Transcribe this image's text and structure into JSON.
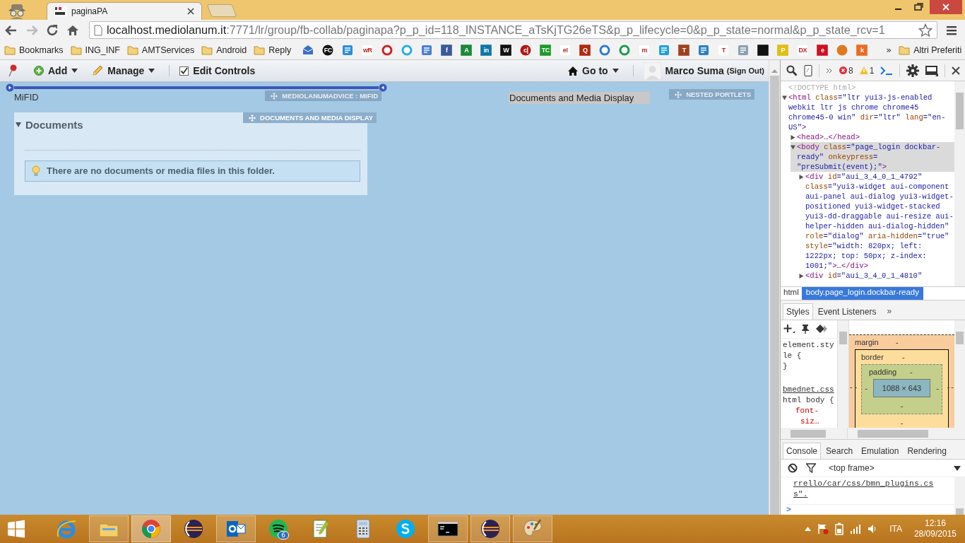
{
  "browser": {
    "tabs": [
      {
        "title": "paginaPA",
        "selected": true
      }
    ],
    "url": {
      "host": "localhost.mediolanum.it",
      "path": ":7771/lr/group/fb-collab/paginapa?p_p_id=118_INSTANCE_aTsKjTG26eTS&p_p_lifecycle=0&p_p_state=normal&p_p_state_rcv=1"
    },
    "bookmarks": {
      "folders": [
        "Bookmarks",
        "ING_INF",
        "AMTServices",
        "Android",
        "Reply"
      ],
      "sites": [
        {
          "kind": "mail",
          "color": "#3b6fc4"
        },
        {
          "kind": "circle",
          "color": "#111111",
          "glyph": "FC"
        },
        {
          "kind": "box",
          "color": "#2a8ee0"
        },
        {
          "kind": "square",
          "color": "#ffffff",
          "glyph": "wR"
        },
        {
          "kind": "ring",
          "color": "#d02020"
        },
        {
          "kind": "ring",
          "color": "#20b0e0"
        },
        {
          "kind": "box",
          "color": "#4a7fd8"
        },
        {
          "kind": "square",
          "color": "#3b5998",
          "glyph": "f"
        },
        {
          "kind": "square",
          "color": "#1a8a3a",
          "glyph": "A"
        },
        {
          "kind": "square",
          "color": "#0e76a8",
          "glyph": "in"
        },
        {
          "kind": "square",
          "color": "#111111",
          "glyph": "W"
        },
        {
          "kind": "circle",
          "color": "#b01818",
          "glyph": "c|"
        },
        {
          "kind": "square",
          "color": "#1a9a2a",
          "glyph": "TC"
        },
        {
          "kind": "square",
          "color": "#ffffff",
          "glyph": "e!"
        },
        {
          "kind": "square",
          "color": "#b02a10",
          "glyph": "Q"
        },
        {
          "kind": "ring",
          "color": "#2a7ad8"
        },
        {
          "kind": "ring",
          "color": "#1a9a4a"
        },
        {
          "kind": "square",
          "color": "#ffffff",
          "glyph": "m"
        },
        {
          "kind": "box",
          "color": "#20a0e0"
        },
        {
          "kind": "square",
          "color": "#a0401a",
          "glyph": "T"
        },
        {
          "kind": "box",
          "color": "#2a80c0"
        },
        {
          "kind": "square",
          "color": "#ffffff",
          "glyph": "T"
        },
        {
          "kind": "box",
          "color": "#8aa0b0"
        },
        {
          "kind": "square",
          "color": "#111111"
        },
        {
          "kind": "square",
          "color": "#e0c010",
          "glyph": "P"
        },
        {
          "kind": "square",
          "color": "#ffffff",
          "glyph": "DX"
        },
        {
          "kind": "square",
          "color": "#d01020",
          "glyph": "e"
        },
        {
          "kind": "circle",
          "color": "#e07a20"
        },
        {
          "kind": "square",
          "color": "#f06a20",
          "glyph": "k"
        }
      ],
      "overflow": "»",
      "other": "Altri Preferiti"
    }
  },
  "dockbar": {
    "menus": [
      {
        "kind": "add",
        "label": "Add"
      },
      {
        "kind": "manage",
        "label": "Manage"
      }
    ],
    "edit_controls": {
      "label": "Edit Controls",
      "checked": true
    },
    "goto": "Go to",
    "user": {
      "name": "Marco Suma",
      "sign_out": "(Sign Out)"
    }
  },
  "page": {
    "column_title": "MiFID",
    "column_handle": "MEDIOLANUMADVICE : MIFID",
    "portlet": {
      "handle": "DOCUMENTS AND MEDIA DISPLAY",
      "title": "Documents",
      "expanded": true,
      "message": "There are no documents or media files in this folder."
    },
    "right_label": "Documents and Media Display",
    "nested_handle": "NESTED PORTLETS"
  },
  "devtools": {
    "errors": "8",
    "warnings": "1",
    "tree": [
      {
        "kind": "leaf",
        "selected": false,
        "tokens": [
          {
            "kind": "doctype",
            "text": "<!DOCTYPE html>"
          }
        ]
      },
      {
        "kind": "element",
        "expanded": true,
        "selected": false,
        "tokens": [
          {
            "kind": "tag",
            "text": "<html"
          },
          {
            "kind": "attr",
            "text": " class"
          },
          {
            "kind": "value",
            "text": "=\"ltr yui3-js-enabled webkit ltr js chrome chrome45 chrome45-0 win\""
          },
          {
            "kind": "attr",
            "text": " dir"
          },
          {
            "kind": "value",
            "text": "=\"ltr\""
          },
          {
            "kind": "attr",
            "text": " lang"
          },
          {
            "kind": "value",
            "text": "=\"en-US\""
          },
          {
            "kind": "tag",
            "text": ">"
          }
        ],
        "children": [
          {
            "kind": "element",
            "expanded": false,
            "selected": false,
            "tokens": [
              {
                "kind": "tag",
                "text": "<head>"
              },
              {
                "kind": "plain",
                "text": "…"
              },
              {
                "kind": "tag",
                "text": "</head>"
              }
            ]
          },
          {
            "kind": "element",
            "expanded": true,
            "selected": true,
            "tokens": [
              {
                "kind": "tag",
                "text": "<body"
              },
              {
                "kind": "attr",
                "text": " class"
              },
              {
                "kind": "value",
                "text": "=\"page_login dockbar-ready\""
              },
              {
                "kind": "attr",
                "text": " onkeypress"
              },
              {
                "kind": "value",
                "text": "= \"preSubmit(event);\""
              },
              {
                "kind": "tag",
                "text": ">"
              }
            ],
            "children": [
              {
                "kind": "element",
                "expanded": false,
                "selected": false,
                "tokens": [
                  {
                    "kind": "tag",
                    "text": "<div"
                  },
                  {
                    "kind": "attr",
                    "text": " id"
                  },
                  {
                    "kind": "value",
                    "text": "=\"aui_3_4_0_1_4792\""
                  },
                  {
                    "kind": "attr",
                    "text": " class"
                  },
                  {
                    "kind": "value",
                    "text": "=\"yui3-widget aui-component aui-panel aui-dialog yui3-widget-positioned yui3-widget-stacked yui3-dd-draggable aui-resize aui-helper-hidden aui-dialog-hidden\""
                  },
                  {
                    "kind": "attr",
                    "text": " role"
                  },
                  {
                    "kind": "value",
                    "text": "=\"dialog\""
                  },
                  {
                    "kind": "attr",
                    "text": " aria-hidden"
                  },
                  {
                    "kind": "value",
                    "text": "=\"true\""
                  },
                  {
                    "kind": "attr",
                    "text": " style"
                  },
                  {
                    "kind": "value",
                    "text": "=\"width: 820px; left: 1222px; top: 50px; z-index: 1001;\""
                  },
                  {
                    "kind": "tag",
                    "text": ">"
                  },
                  {
                    "kind": "plain",
                    "text": "…"
                  },
                  {
                    "kind": "tag",
                    "text": "</div>"
                  }
                ]
              },
              {
                "kind": "element",
                "expanded": false,
                "selected": false,
                "tokens": [
                  {
                    "kind": "tag",
                    "text": "<div"
                  },
                  {
                    "kind": "attr",
                    "text": " id"
                  },
                  {
                    "kind": "value",
                    "text": "=\"aui_3_4_0_1_4810\""
                  }
                ]
              }
            ]
          }
        ]
      }
    ],
    "breadcrumbs": [
      {
        "label": "html",
        "selected": false
      },
      {
        "label": "body.page_login.dockbar-ready",
        "selected": true
      }
    ],
    "side_tabs": [
      {
        "label": "Styles",
        "selected": true
      },
      {
        "label": "Event Listeners",
        "selected": false
      }
    ],
    "side_more": "»",
    "styles": [
      {
        "kind": "selector",
        "text": "element.style {"
      },
      {
        "kind": "brace",
        "text": "}"
      },
      {
        "kind": "source",
        "text": "bmednet.css"
      },
      {
        "kind": "selector",
        "text": "html body {"
      },
      {
        "kind": "property",
        "text": "font-"
      },
      {
        "kind": "property",
        "text": "siz…"
      }
    ],
    "box_model": {
      "margin": {
        "label": "margin",
        "top": "-",
        "left": "-",
        "right": "-"
      },
      "border": {
        "label": "border",
        "top": "-",
        "left": "-",
        "right": "-",
        "bottom": "-"
      },
      "padding": {
        "label": "padding",
        "top": "-",
        "left": "-",
        "right": "-",
        "bottom": "-"
      },
      "content": "1088 × 643"
    },
    "drawer_tabs": [
      {
        "label": "Console",
        "selected": true
      },
      {
        "label": "Search",
        "selected": false
      },
      {
        "label": "Emulation",
        "selected": false
      },
      {
        "label": "Rendering",
        "selected": false
      }
    ],
    "frame": "<top frame>",
    "console_lines": [
      "rrello/car/css/bmn_plugins.cs",
      "s\"."
    ],
    "prompt": ">"
  },
  "taskbar": {
    "apps": [
      {
        "kind": "ie",
        "running": false,
        "selected": false
      },
      {
        "kind": "explorer",
        "running": true,
        "selected": false
      },
      {
        "kind": "chrome",
        "running": true,
        "selected": true
      },
      {
        "kind": "eclipse",
        "running": false,
        "selected": false
      },
      {
        "kind": "outlook",
        "running": true,
        "selected": false
      },
      {
        "kind": "spotify",
        "running": false,
        "selected": false,
        "badge": "6"
      },
      {
        "kind": "notepad",
        "running": false,
        "selected": false
      },
      {
        "kind": "calculator",
        "running": false,
        "selected": false
      },
      {
        "kind": "skype",
        "running": false,
        "selected": false
      },
      {
        "kind": "cmd",
        "running": true,
        "selected": false
      },
      {
        "kind": "eclipse",
        "running": true,
        "selected": false
      },
      {
        "kind": "paint",
        "running": true,
        "selected": false
      }
    ],
    "language": "ITA",
    "time": "12:16",
    "date": "28/09/2015"
  }
}
